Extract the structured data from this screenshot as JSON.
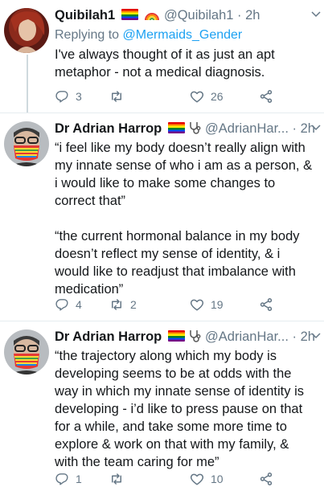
{
  "tweets": [
    {
      "name": "Quibilah1",
      "handle": "@Quibilah1",
      "dot": "·",
      "time": "2h",
      "replying_prefix": "Replying to ",
      "replying_to": "@Mermaids_Gender",
      "text": "I've always thought of it as just an apt metaphor - not a medical diagnosis.",
      "replies": "3",
      "retweets": "",
      "likes": "26"
    },
    {
      "name": "Dr Adrian Harrop",
      "handle": "@AdrianHar...",
      "dot": "·",
      "time": "2h",
      "text": "“i feel like my body doesn’t really align with my innate sense of who i am as a person, & i would like to make some changes to correct that”\n\n“the current hormonal balance in my body doesn’t reflect my sense of identity, & i would like to readjust that imbalance with medication”",
      "replies": "4",
      "retweets": "2",
      "likes": "19"
    },
    {
      "name": "Dr Adrian Harrop",
      "handle": "@AdrianHar...",
      "dot": "·",
      "time": "2h",
      "text": "“the trajectory along which my body is developing seems to be at odds with the way in which my innate sense of identity is developing - i’d like to press pause on that for a while, and take some more time to explore & work on that with my family, & with the team caring for me”",
      "replies": "1",
      "retweets": "",
      "likes": "10"
    }
  ],
  "colors": {
    "accent": "#1da1f2",
    "muted": "#657786",
    "text": "#14171a"
  },
  "icons": [
    "reply-icon",
    "retweet-icon",
    "like-icon",
    "share-icon",
    "chevron-down-icon",
    "rainbow-flag-icon",
    "rainbow-icon",
    "stethoscope-icon"
  ]
}
